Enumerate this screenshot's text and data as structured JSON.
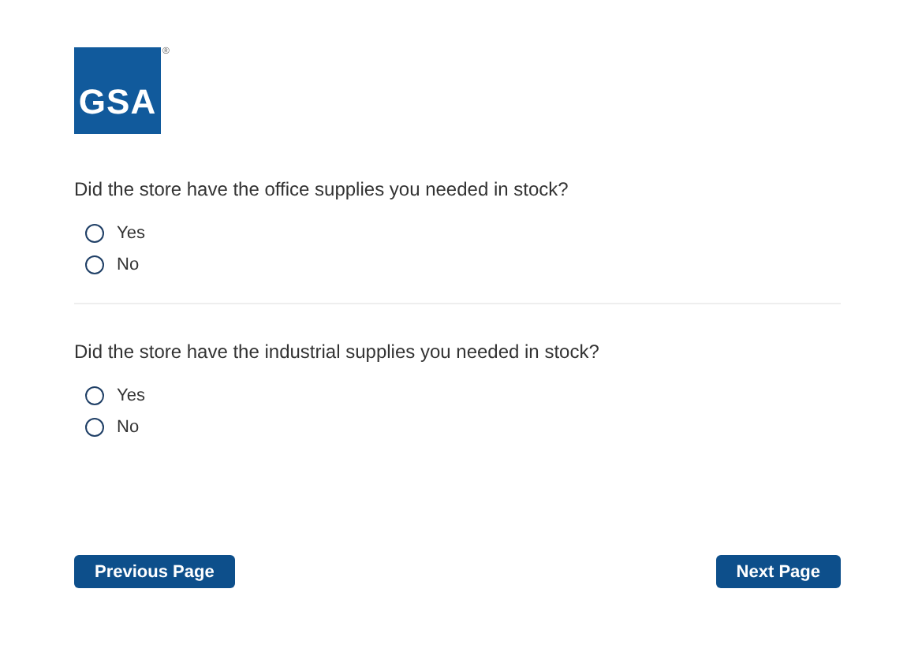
{
  "logo": {
    "text": "GSA",
    "mark": "®"
  },
  "questions": [
    {
      "text": "Did the store have the office supplies you needed in stock?",
      "options": [
        {
          "label": "Yes",
          "selected": false
        },
        {
          "label": "No",
          "selected": false
        }
      ]
    },
    {
      "text": "Did the store have the industrial supplies you needed in stock?",
      "options": [
        {
          "label": "Yes",
          "selected": false
        },
        {
          "label": "No",
          "selected": false
        }
      ]
    }
  ],
  "buttons": {
    "previous": "Previous Page",
    "next": "Next Page"
  }
}
